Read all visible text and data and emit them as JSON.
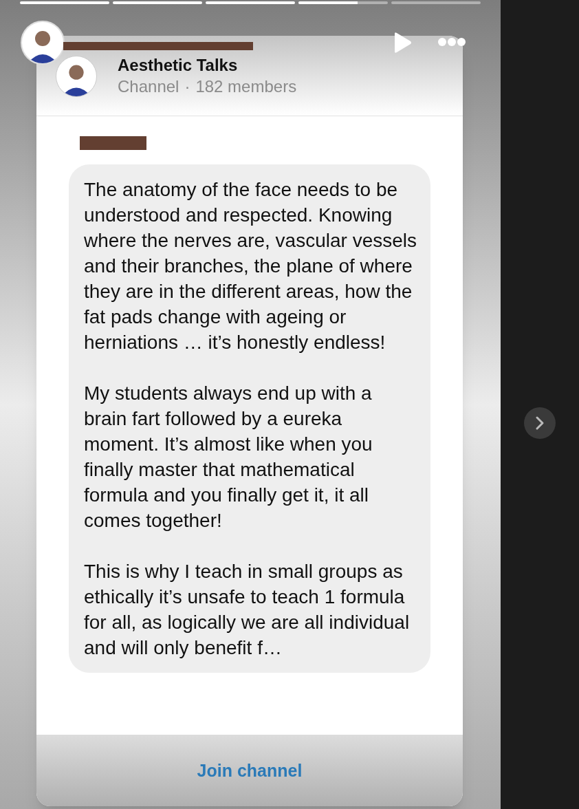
{
  "story_progress": [
    {
      "level": 1
    },
    {
      "level": 1
    },
    {
      "level": 1
    },
    {
      "level": 0.66
    },
    {
      "level": 0
    }
  ],
  "channel": {
    "name": "Aesthetic Talks",
    "type": "Channel",
    "separator": "·",
    "members": "182 members"
  },
  "message": {
    "paragraphs": [
      "The anatomy of the face needs to be understood and respected. Knowing where the nerves are, vascular vessels and their branches, the plane of where they are in the different areas, how the fat pads change with ageing or herniations … it’s honestly endless!",
      "My students always end up with a brain fart followed by a eureka moment. It’s almost like when you finally master that mathematical formula and you finally get it, it all comes together!",
      "This is why I teach in small groups as ethically it’s unsafe to teach 1 formula for all, as logically we are all individual and will only benefit f…"
    ]
  },
  "action": "Join channel"
}
